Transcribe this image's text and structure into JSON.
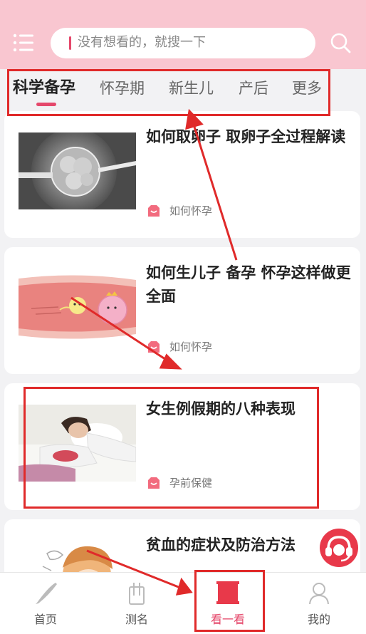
{
  "header": {
    "menu_icon": "menu-icon",
    "search_placeholder": "没有想看的，就搜一下",
    "search_icon": "search-icon",
    "background_color": "#f9c6d0"
  },
  "tabs": [
    {
      "label": "科学备孕",
      "active": true
    },
    {
      "label": "怀孕期",
      "active": false
    },
    {
      "label": "新生儿",
      "active": false
    },
    {
      "label": "产后",
      "active": false
    },
    {
      "label": "更多",
      "active": false
    }
  ],
  "articles": [
    {
      "title": "如何取卵子 取卵子全过程解读",
      "category": "如何怀孕"
    },
    {
      "title": "如何生儿子 备孕 怀孕这样做更全面",
      "category": "如何怀孕"
    },
    {
      "title": "女生例假期的八种表现",
      "category": "孕前保健"
    },
    {
      "title": "贫血的症状及防治方法",
      "category": ""
    }
  ],
  "tabbar": [
    {
      "label": "首页",
      "icon": "home-icon",
      "active": false
    },
    {
      "label": "测名",
      "icon": "naming-icon",
      "active": false
    },
    {
      "label": "看一看",
      "icon": "look-icon",
      "active": true
    },
    {
      "label": "我的",
      "icon": "profile-icon",
      "active": false
    }
  ],
  "colors": {
    "accent": "#e5486b",
    "annotation": "#e02a2a"
  }
}
